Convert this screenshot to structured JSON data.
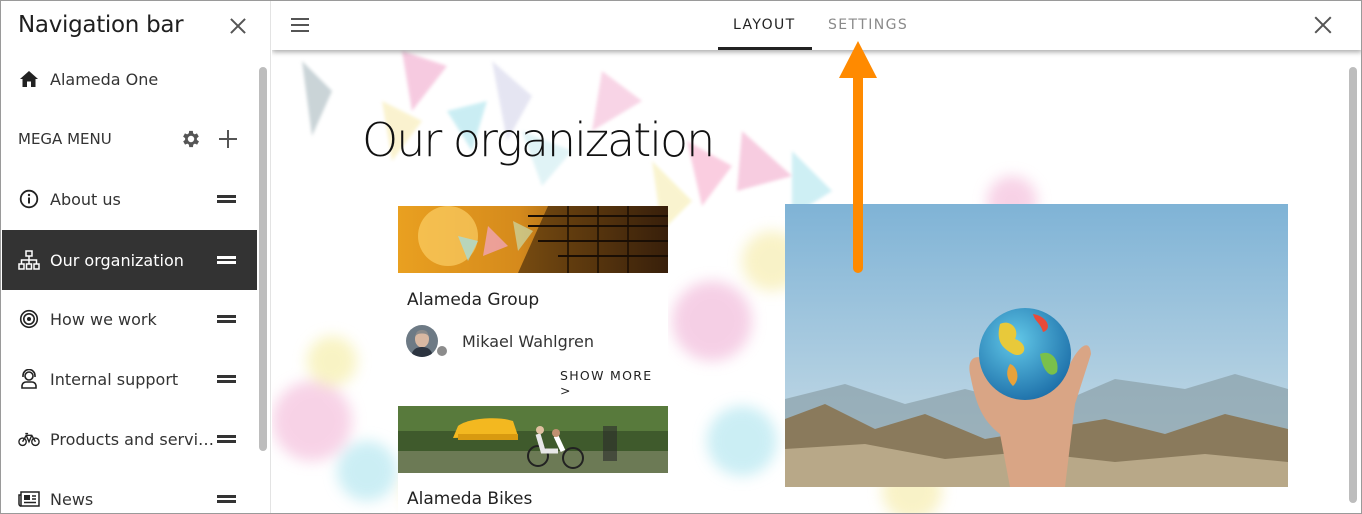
{
  "sidebar": {
    "title": "Navigation bar",
    "home": {
      "label": "Alameda One",
      "icon": "home-icon"
    },
    "mega_menu": {
      "label": "MEGA MENU"
    },
    "items": [
      {
        "label": "About us",
        "icon": "info-icon"
      },
      {
        "label": "Our organization",
        "icon": "org-chart-icon",
        "active": true
      },
      {
        "label": "How we work",
        "icon": "target-icon"
      },
      {
        "label": "Internal support",
        "icon": "support-agent-icon"
      },
      {
        "label": "Products and servi…",
        "icon": "bicycle-icon"
      },
      {
        "label": "News",
        "icon": "newspaper-icon"
      }
    ]
  },
  "topbar": {
    "tabs": [
      {
        "label": "LAYOUT",
        "active": true
      },
      {
        "label": "SETTINGS",
        "active": false
      }
    ]
  },
  "page": {
    "title": "Our organization",
    "cards": [
      {
        "title": "Alameda Group",
        "person": "Mikael Wahlgren",
        "show_more": "SHOW MORE >"
      },
      {
        "title": "Alameda Bikes"
      }
    ]
  },
  "colors": {
    "active_item_bg": "#333333",
    "annotation_arrow": "#ff8a00"
  }
}
